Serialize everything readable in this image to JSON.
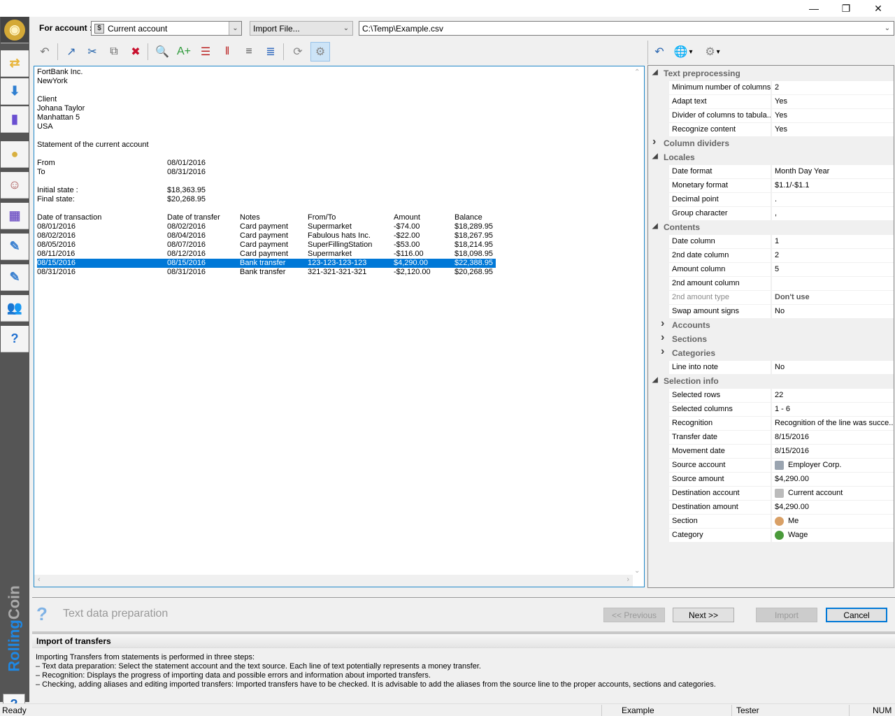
{
  "window": {
    "minimize_glyph": "—",
    "maximize_glyph": "❐",
    "close_glyph": "✕"
  },
  "sidebar": {
    "items": [
      {
        "name": "home",
        "icon": "rollingcoin-logo-icon",
        "glyph": "◉",
        "color": "#d4a937"
      },
      {
        "name": "transfers",
        "icon": "globe-transfer-icon",
        "glyph": "⇄",
        "color": "#e8b63d"
      },
      {
        "name": "import",
        "icon": "import-download-icon",
        "glyph": "⬇",
        "color": "#2f7fd1"
      },
      {
        "name": "reports",
        "icon": "bar-chart-icon",
        "glyph": "▮",
        "color": "#6a4fd1"
      },
      {
        "name": "accounts",
        "icon": "coin-notebook-icon",
        "glyph": "●",
        "color": "#d8b040"
      },
      {
        "name": "sections",
        "icon": "people-notebook-icon",
        "glyph": "☺",
        "color": "#a55"
      },
      {
        "name": "categories",
        "icon": "categories-notebook-icon",
        "glyph": "▦",
        "color": "#7a5fc8"
      },
      {
        "name": "user-notes",
        "icon": "user-edit-notebook-icon",
        "glyph": "✎",
        "color": "#3a80d0"
      },
      {
        "name": "notes",
        "icon": "edit-notebook-icon",
        "glyph": "✎",
        "color": "#3a80d0"
      },
      {
        "name": "users",
        "icon": "users-group-icon",
        "glyph": "👥",
        "color": "#c06030"
      },
      {
        "name": "help",
        "icon": "help-book-icon",
        "glyph": "?",
        "color": "#1e6fd0"
      }
    ],
    "brand_part1": "Rolling",
    "brand_part2": "Coin",
    "help_glyph": "?"
  },
  "top": {
    "for_account_label": "For account :",
    "account_value": "Current account",
    "import_value": "Import File...",
    "path_value": "C:\\Temp\\Example.csv"
  },
  "toolbar": {
    "buttons": [
      {
        "name": "undo",
        "glyph": "↶"
      },
      {
        "name": "export-file",
        "glyph": "↗"
      },
      {
        "name": "cut",
        "glyph": "✂"
      },
      {
        "name": "move-copy",
        "glyph": "⧉"
      },
      {
        "name": "delete",
        "glyph": "✖"
      },
      {
        "name": "find",
        "glyph": "🔍"
      },
      {
        "name": "add-text",
        "glyph": "A+"
      },
      {
        "name": "remove-row-divider",
        "glyph": "☰"
      },
      {
        "name": "remove-column-divider",
        "glyph": "‖"
      },
      {
        "name": "join-rows",
        "glyph": "≡"
      },
      {
        "name": "join-columns",
        "glyph": "≣"
      },
      {
        "name": "refresh",
        "glyph": "⟳"
      },
      {
        "name": "settings",
        "glyph": "⚙"
      }
    ],
    "right_buttons": [
      {
        "name": "undo-right",
        "glyph": "↶"
      },
      {
        "name": "globe-dropdown",
        "glyph": "🌐"
      },
      {
        "name": "settings-dropdown",
        "glyph": "⚙"
      }
    ]
  },
  "statement": {
    "header_lines": [
      [
        "FortBank Inc.",
        ""
      ],
      [
        "NewYork",
        ""
      ],
      [
        "",
        ""
      ],
      [
        "Client",
        ""
      ],
      [
        "Johana Taylor",
        ""
      ],
      [
        "Manhattan 5",
        ""
      ],
      [
        "USA",
        ""
      ],
      [
        "",
        ""
      ],
      [
        "Statement of the current account",
        ""
      ],
      [
        "",
        ""
      ],
      [
        "From",
        "08/01/2016"
      ],
      [
        "To",
        "08/31/2016"
      ],
      [
        "",
        ""
      ],
      [
        "Initial state :",
        "$18,363.95"
      ],
      [
        "Final state:",
        "$20,268.95"
      ],
      [
        "",
        ""
      ]
    ],
    "columns": [
      "Date of transaction",
      "Date of transfer",
      "Notes",
      "From/To",
      "Amount",
      "Balance"
    ],
    "rows": [
      [
        "08/01/2016",
        "08/02/2016",
        "Card payment",
        "Supermarket",
        "-$74.00",
        "$18,289.95"
      ],
      [
        "08/02/2016",
        "08/04/2016",
        "Card payment",
        "Fabulous hats Inc.",
        "-$22.00",
        "$18,267.95"
      ],
      [
        "08/05/2016",
        "08/07/2016",
        "Card payment",
        "SuperFillingStation",
        "-$53.00",
        "$18,214.95"
      ],
      [
        "08/11/2016",
        "08/12/2016",
        "Card payment",
        "Supermarket",
        "-$116.00",
        "$18,098.95"
      ],
      [
        "08/15/2016",
        "08/15/2016",
        "Bank transfer",
        "123-123-123-123",
        "$4,290.00",
        "$22,388.95"
      ],
      [
        "08/31/2016",
        "08/31/2016",
        "Bank transfer",
        "321-321-321-321",
        "-$2,120.00",
        "$20,268.95"
      ]
    ],
    "selected_row": 4
  },
  "properties": [
    {
      "type": "cat",
      "label": "Text preprocessing",
      "expanded": true
    },
    {
      "type": "item",
      "name": "Minimum number of columns",
      "value": "2"
    },
    {
      "type": "item",
      "name": "Adapt text",
      "value": "Yes"
    },
    {
      "type": "item",
      "name": "Divider of columns to tabula...",
      "value": "Yes"
    },
    {
      "type": "item",
      "name": "Recognize content",
      "value": "Yes"
    },
    {
      "type": "cat",
      "label": "Column dividers",
      "expanded": false
    },
    {
      "type": "cat",
      "label": "Locales",
      "expanded": true
    },
    {
      "type": "item",
      "name": "Date format",
      "value": "Month Day Year"
    },
    {
      "type": "item",
      "name": "Monetary format",
      "value": "$1.1/-$1.1"
    },
    {
      "type": "item",
      "name": "Decimal point",
      "value": "."
    },
    {
      "type": "item",
      "name": "Group character",
      "value": ","
    },
    {
      "type": "cat",
      "label": "Contents",
      "expanded": true
    },
    {
      "type": "item",
      "name": "Date column",
      "value": "1"
    },
    {
      "type": "item",
      "name": "2nd date column",
      "value": "2"
    },
    {
      "type": "item",
      "name": "Amount column",
      "value": "5"
    },
    {
      "type": "item",
      "name": "2nd amount column",
      "value": ""
    },
    {
      "type": "item",
      "name": "2nd amount type",
      "value": "Don't use",
      "disabled": true
    },
    {
      "type": "item",
      "name": "Swap amount signs",
      "value": "No"
    },
    {
      "type": "subcat",
      "label": "Accounts",
      "expanded": false
    },
    {
      "type": "subcat",
      "label": "Sections",
      "expanded": false
    },
    {
      "type": "subcat",
      "label": "Categories",
      "expanded": false
    },
    {
      "type": "item",
      "name": "Line into note",
      "value": "No"
    },
    {
      "type": "cat",
      "label": "Selection info",
      "expanded": true
    },
    {
      "type": "item",
      "name": "Selected rows",
      "value": "22"
    },
    {
      "type": "item",
      "name": "Selected columns",
      "value": "1 - 6"
    },
    {
      "type": "item",
      "name": "Recognition",
      "value": "Recognition of the line was succe..."
    },
    {
      "type": "item",
      "name": "Transfer date",
      "value": "8/15/2016"
    },
    {
      "type": "item",
      "name": "Movement date",
      "value": "8/15/2016"
    },
    {
      "type": "item",
      "name": "Source account",
      "value": "Employer Corp.",
      "icon": "building-icon",
      "icon_color": "#9aa4b0"
    },
    {
      "type": "item",
      "name": "Source amount",
      "value": "$4,290.00"
    },
    {
      "type": "item",
      "name": "Destination account",
      "value": "Current account",
      "icon": "bank-account-icon",
      "icon_color": "#bbbbbb"
    },
    {
      "type": "item",
      "name": "Destination amount",
      "value": "$4,290.00"
    },
    {
      "type": "item",
      "name": "Section",
      "value": "Me",
      "icon": "person-icon",
      "icon_color": "#d9a066"
    },
    {
      "type": "item",
      "name": "Category",
      "value": "Wage",
      "icon": "wage-icon",
      "icon_color": "#4a9a3a"
    }
  ],
  "wizard": {
    "step_title": "Text data preparation",
    "prev_label": "<< Previous",
    "next_label": "Next >>",
    "import_label": "Import",
    "cancel_label": "Cancel"
  },
  "info": {
    "title": "Import of transfers",
    "lines": [
      "Importing Transfers from statements is performed in three steps:",
      "– Text data preparation: Select the statement account and the text source. Each line of text potentially represents a money transfer.",
      "– Recognition: Displays the progress of importing data and possible errors and information about imported transfers.",
      "– Checking, adding aliases and editing imported transfers: Imported transfers have to be checked. It is advisable to add the aliases from the source line to the proper accounts, sections and categories."
    ]
  },
  "status": {
    "ready": "Ready",
    "file": "Example",
    "user": "Tester",
    "num": "NUM"
  }
}
